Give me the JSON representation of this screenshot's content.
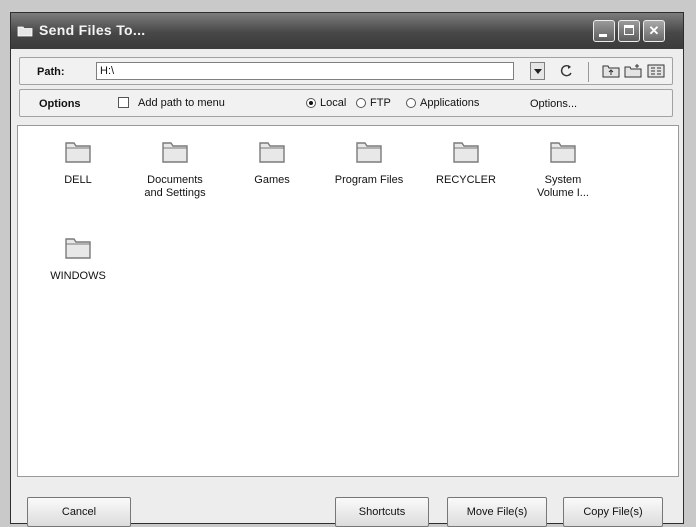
{
  "window": {
    "title": "Send Files To..."
  },
  "pathbar": {
    "label": "Path:",
    "value": "H:\\"
  },
  "optbar": {
    "label": "Options",
    "add_path_label": "Add path to menu",
    "radio_local": "Local",
    "radio_ftp": "FTP",
    "radio_applications": "Applications",
    "selected": "Local",
    "options_label": "Options..."
  },
  "folders": [
    {
      "line1": "DELL",
      "line2": ""
    },
    {
      "line1": "Documents",
      "line2": "and Settings"
    },
    {
      "line1": "Games",
      "line2": ""
    },
    {
      "line1": "Program Files",
      "line2": ""
    },
    {
      "line1": "RECYCLER",
      "line2": ""
    },
    {
      "line1": "System",
      "line2": "Volume I..."
    },
    {
      "line1": "WINDOWS",
      "line2": ""
    }
  ],
  "buttons": {
    "cancel": "Cancel",
    "shortcuts": "Shortcuts",
    "move": "Move File(s)",
    "copy": "Copy File(s)"
  },
  "icons": {
    "folder_color": "#e8e8e8",
    "folder_stroke": "#7a7a7a"
  }
}
